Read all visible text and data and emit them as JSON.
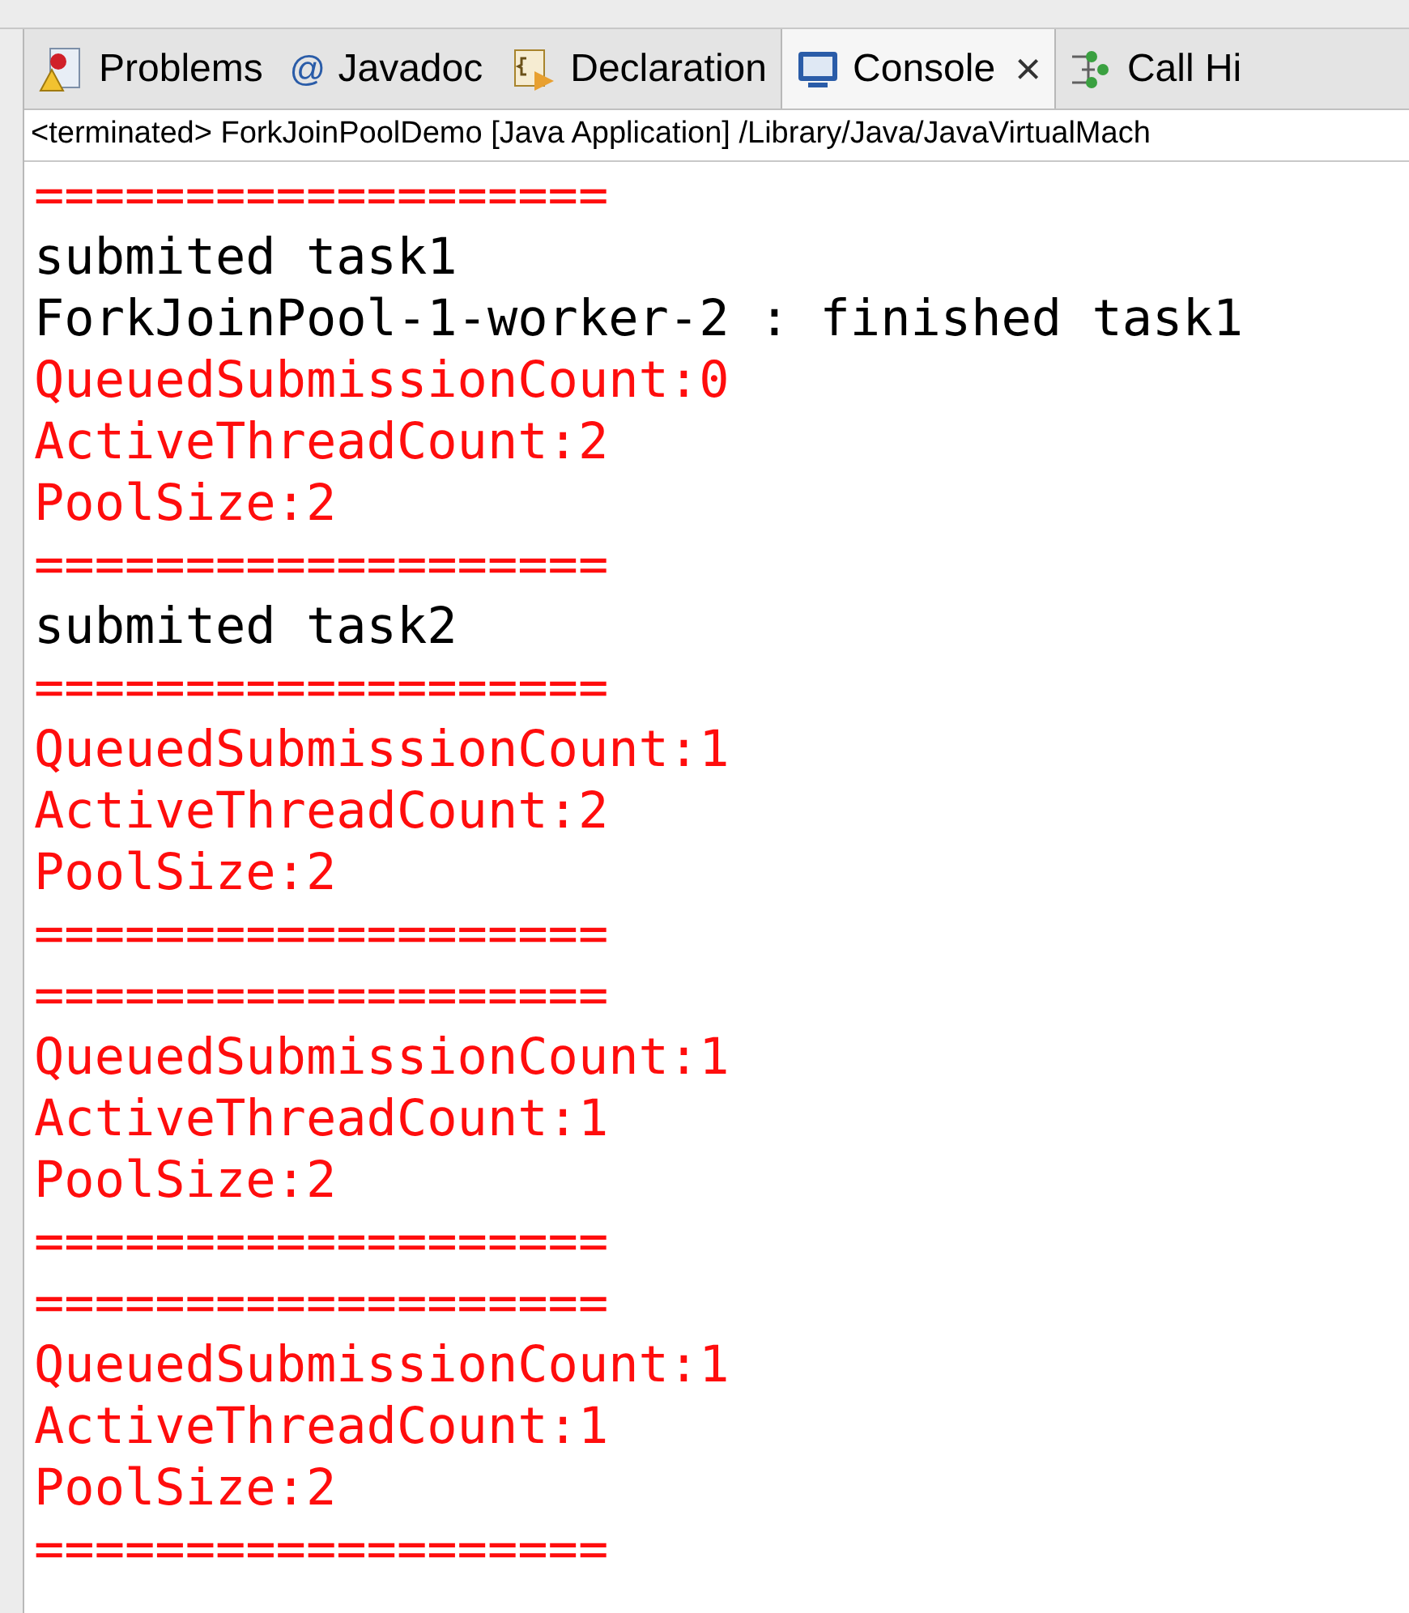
{
  "tabs": [
    {
      "label": "Problems",
      "kind": "problems",
      "selected": false
    },
    {
      "label": "Javadoc",
      "kind": "javadoc",
      "icon_char": "@",
      "selected": false
    },
    {
      "label": "Declaration",
      "kind": "declaration",
      "selected": false
    },
    {
      "label": "Console",
      "kind": "console",
      "selected": true,
      "close_label": "×"
    },
    {
      "label": "Call Hi",
      "kind": "hierarchy",
      "selected": false
    }
  ],
  "console": {
    "title": "<terminated> ForkJoinPoolDemo [Java Application] /Library/Java/JavaVirtualMach",
    "lines": [
      {
        "kind": "err",
        "text": "==================="
      },
      {
        "kind": "out",
        "text": "submited task1"
      },
      {
        "kind": "out",
        "text": "ForkJoinPool-1-worker-2 : finished task1"
      },
      {
        "kind": "err",
        "text": "QueuedSubmissionCount:0"
      },
      {
        "kind": "err",
        "text": "ActiveThreadCount:2"
      },
      {
        "kind": "err",
        "text": "PoolSize:2"
      },
      {
        "kind": "err",
        "text": "==================="
      },
      {
        "kind": "out",
        "text": "submited task2"
      },
      {
        "kind": "err",
        "text": "==================="
      },
      {
        "kind": "err",
        "text": "QueuedSubmissionCount:1"
      },
      {
        "kind": "err",
        "text": "ActiveThreadCount:2"
      },
      {
        "kind": "err",
        "text": "PoolSize:2"
      },
      {
        "kind": "err",
        "text": "==================="
      },
      {
        "kind": "err",
        "text": "==================="
      },
      {
        "kind": "err",
        "text": "QueuedSubmissionCount:1"
      },
      {
        "kind": "err",
        "text": "ActiveThreadCount:1"
      },
      {
        "kind": "err",
        "text": "PoolSize:2"
      },
      {
        "kind": "err",
        "text": "==================="
      },
      {
        "kind": "err",
        "text": "==================="
      },
      {
        "kind": "err",
        "text": "QueuedSubmissionCount:1"
      },
      {
        "kind": "err",
        "text": "ActiveThreadCount:1"
      },
      {
        "kind": "err",
        "text": "PoolSize:2"
      },
      {
        "kind": "err",
        "text": "==================="
      }
    ]
  }
}
